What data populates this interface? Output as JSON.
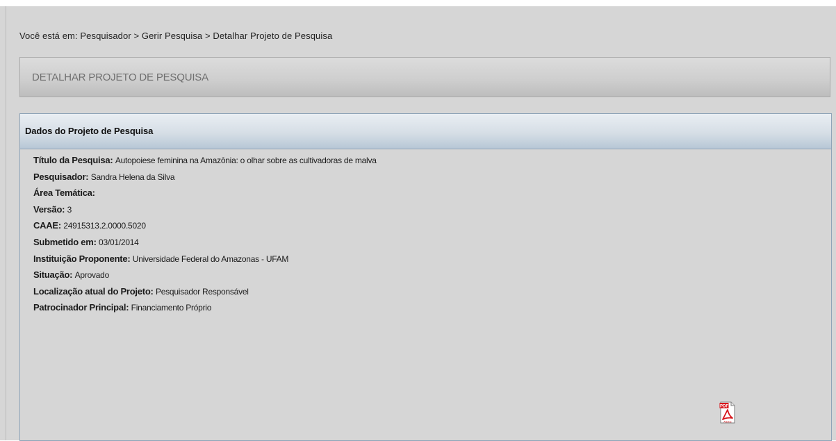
{
  "breadcrumb": "Você está em: Pesquisador > Gerir Pesquisa > Detalhar Projeto de Pesquisa",
  "page_title": "DETALHAR PROJETO DE PESQUISA",
  "panel": {
    "title": "Dados do Projeto de Pesquisa",
    "fields": [
      {
        "label": "Título da Pesquisa:",
        "value": "Autopoiese feminina na Amazônia: o olhar sobre as cultivadoras de malva"
      },
      {
        "label": "Pesquisador:",
        "value": "Sandra Helena da Silva"
      },
      {
        "label": "Área Temática:",
        "value": ""
      },
      {
        "label": "Versão:",
        "value": "3"
      },
      {
        "label": "CAAE:",
        "value": "24915313.2.0000.5020"
      },
      {
        "label": "Submetido em:",
        "value": "03/01/2014"
      },
      {
        "label": "Instituição Proponente:",
        "value": "Universidade Federal do Amazonas - UFAM"
      },
      {
        "label": "Situação:",
        "value": "Aprovado"
      },
      {
        "label": "Localização atual do Projeto:",
        "value": "Pesquisador Responsável"
      },
      {
        "label": "Patrocinador Principal:",
        "value": " Financiamento Próprio"
      }
    ]
  },
  "pdf_icon": {
    "name": "pdf-icon",
    "label": "PDF",
    "caption": "Adobe"
  },
  "colors": {
    "page_background": "#d6d6d6",
    "panel_border": "#8fa4b8",
    "pdf_red": "#d7141a"
  }
}
